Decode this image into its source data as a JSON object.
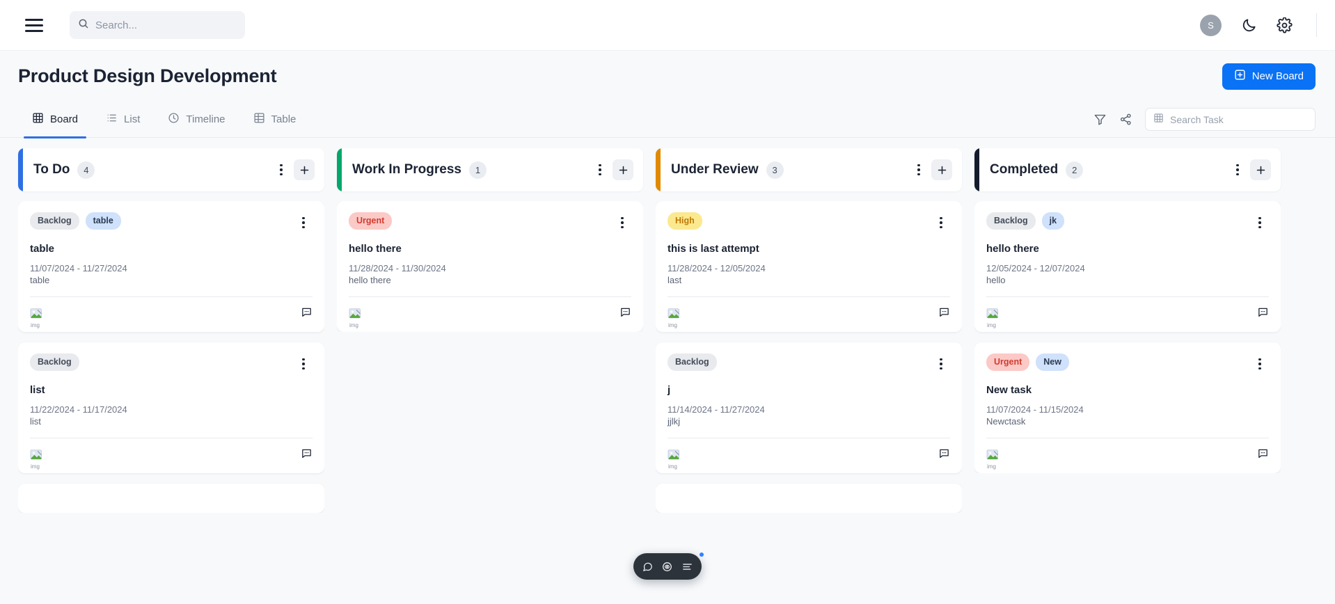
{
  "topbar": {
    "menu_icon": "hamburger-icon",
    "search": {
      "placeholder": "Search...",
      "value": ""
    },
    "avatar_initial": "S",
    "theme_icon": "moon-icon",
    "settings_icon": "gear-icon"
  },
  "page": {
    "title": "Product Design Development",
    "new_board_label": "New Board"
  },
  "tabs": [
    {
      "label": "Board",
      "icon": "grid-icon",
      "active": true
    },
    {
      "label": "List",
      "icon": "list-icon",
      "active": false
    },
    {
      "label": "Timeline",
      "icon": "clock-icon",
      "active": false
    },
    {
      "label": "Table",
      "icon": "table-icon",
      "active": false
    }
  ],
  "toolbar": {
    "filter_icon": "filter-icon",
    "share_icon": "share-icon",
    "task_search": {
      "placeholder": "Search Task",
      "value": "",
      "icon": "grid-icon"
    }
  },
  "colors": {
    "accent_blue": "#0a72f5",
    "todo": "#2f6fe4",
    "in_progress": "#00a86b",
    "under_review": "#e08a00",
    "completed": "#141b2d",
    "tag_gray_bg": "#e8eaee",
    "tag_blue_bg": "#cfe1fb",
    "tag_red_bg": "#fbc9c6",
    "tag_yellow_bg": "#fbe98f"
  },
  "columns": [
    {
      "title": "To Do",
      "count": "4",
      "accent": "#2f6fe4",
      "cards": [
        {
          "tags": [
            {
              "label": "Backlog",
              "style": "gray"
            },
            {
              "label": "table",
              "style": "blue"
            }
          ],
          "title": "table",
          "dates": "11/07/2024 - 11/27/2024",
          "desc": "table",
          "avatar_alt": "img",
          "comment_icon": "comment-icon"
        },
        {
          "tags": [
            {
              "label": "Backlog",
              "style": "gray"
            }
          ],
          "title": "list",
          "dates": "11/22/2024 - 11/17/2024",
          "desc": "list",
          "avatar_alt": "img",
          "comment_icon": "comment-icon"
        }
      ],
      "has_partial_card": true
    },
    {
      "title": "Work In Progress",
      "count": "1",
      "accent": "#00a86b",
      "cards": [
        {
          "tags": [
            {
              "label": "Urgent",
              "style": "red"
            }
          ],
          "title": "hello there",
          "dates": "11/28/2024 - 11/30/2024",
          "desc": "hello there",
          "avatar_alt": "img",
          "comment_icon": "comment-icon"
        }
      ],
      "has_partial_card": false
    },
    {
      "title": "Under Review",
      "count": "3",
      "accent": "#e08a00",
      "cards": [
        {
          "tags": [
            {
              "label": "High",
              "style": "yellow"
            }
          ],
          "title": "this is last attempt",
          "dates": "11/28/2024 - 12/05/2024",
          "desc": "last",
          "avatar_alt": "img",
          "comment_icon": "comment-icon"
        },
        {
          "tags": [
            {
              "label": "Backlog",
              "style": "gray"
            }
          ],
          "title": "j",
          "dates": "11/14/2024 - 11/27/2024",
          "desc": "jjlkj",
          "avatar_alt": "img",
          "comment_icon": "comment-icon"
        }
      ],
      "has_partial_card": true
    },
    {
      "title": "Completed",
      "count": "2",
      "accent": "#141b2d",
      "cards": [
        {
          "tags": [
            {
              "label": "Backlog",
              "style": "gray"
            },
            {
              "label": "jk",
              "style": "blue"
            }
          ],
          "title": "hello there",
          "dates": "12/05/2024 - 12/07/2024",
          "desc": "hello",
          "avatar_alt": "img",
          "comment_icon": "comment-icon"
        },
        {
          "tags": [
            {
              "label": "Urgent",
              "style": "red"
            },
            {
              "label": "New",
              "style": "blue"
            }
          ],
          "title": "New task",
          "dates": "11/07/2024 - 11/15/2024",
          "desc": "Newctask",
          "avatar_alt": "img",
          "comment_icon": "comment-icon"
        }
      ],
      "has_partial_card": false
    }
  ],
  "float_toolbar": {
    "items": [
      {
        "icon": "chat-bubble-icon",
        "badge": false
      },
      {
        "icon": "eye-target-icon",
        "badge": false
      },
      {
        "icon": "lines-list-icon",
        "badge": true
      }
    ]
  }
}
